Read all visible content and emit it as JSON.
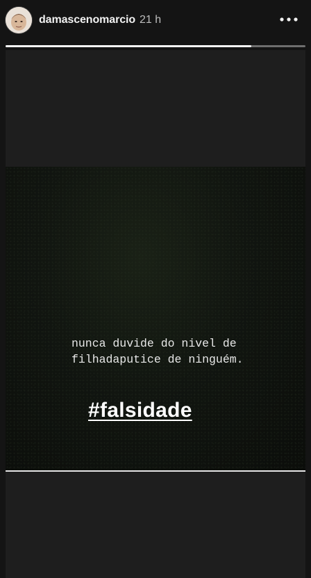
{
  "story": {
    "username": "damascenomarcio",
    "timestamp": "21 h",
    "progress": 0.82
  },
  "post": {
    "quote_line1": "nunca duvide do nivel de",
    "quote_line2": "filhadaputice de ninguém.",
    "hashtag": "#falsidade"
  },
  "icons": {
    "avatar": "profile-photo",
    "menu": "more-horizontal-icon"
  }
}
